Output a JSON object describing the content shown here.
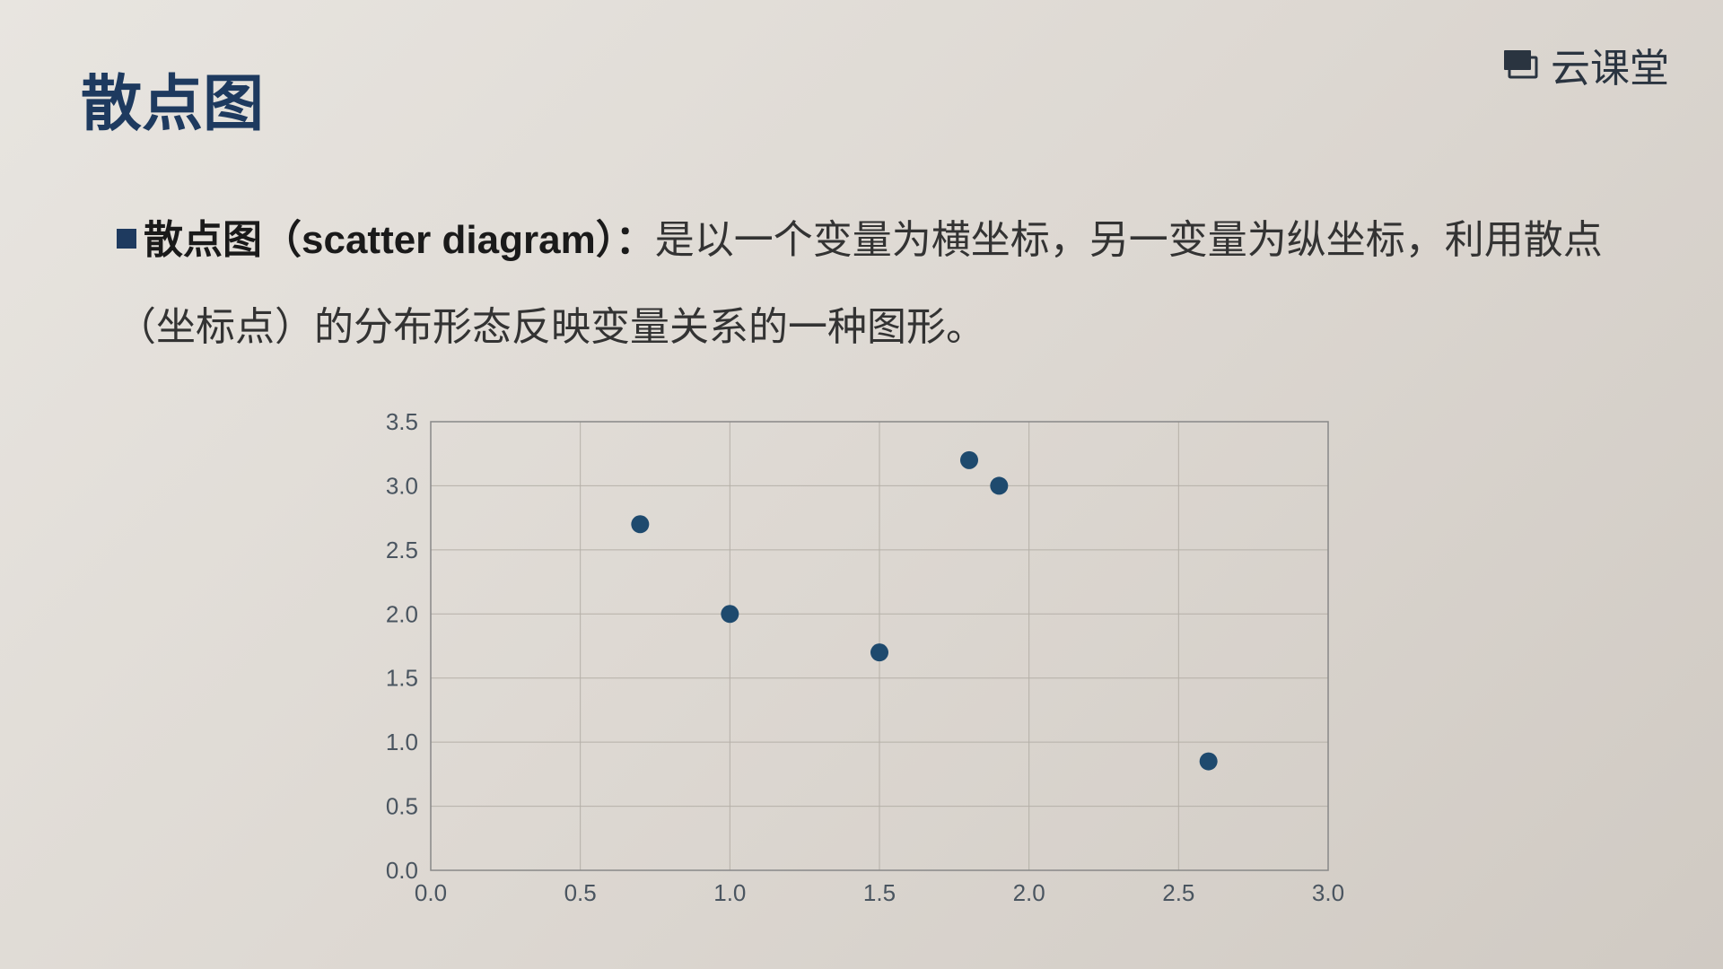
{
  "header": {
    "logo_text": "云课堂"
  },
  "title": "散点图",
  "description": {
    "term": "散点图（scatter diagram）：",
    "body": "是以一个变量为横坐标，另一变量为纵坐标，利用散点（坐标点）的分布形态反映变量关系的一种图形。"
  },
  "chart_data": {
    "type": "scatter",
    "xlabel": "",
    "ylabel": "",
    "xlim": [
      0.0,
      3.0
    ],
    "ylim": [
      0.0,
      3.5
    ],
    "x_ticks": [
      "0.0",
      "0.5",
      "1.0",
      "1.5",
      "2.0",
      "2.5",
      "3.0"
    ],
    "y_ticks": [
      "0.0",
      "0.5",
      "1.0",
      "1.5",
      "2.0",
      "2.5",
      "3.0",
      "3.5"
    ],
    "points": [
      {
        "x": 0.7,
        "y": 2.7
      },
      {
        "x": 1.0,
        "y": 2.0
      },
      {
        "x": 1.5,
        "y": 1.7
      },
      {
        "x": 1.8,
        "y": 3.2
      },
      {
        "x": 1.9,
        "y": 3.0
      },
      {
        "x": 2.6,
        "y": 0.85
      }
    ],
    "point_color": "#1e4a6e",
    "grid": true
  }
}
